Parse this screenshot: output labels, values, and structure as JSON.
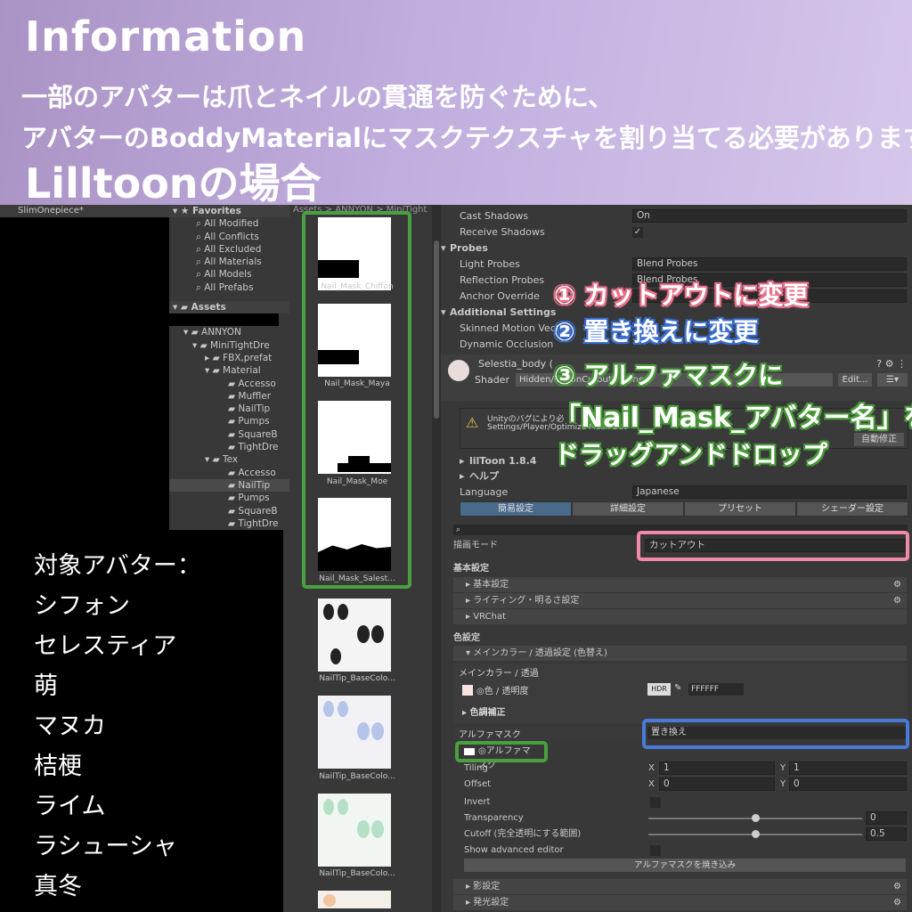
{
  "banner": {
    "title": "Information",
    "line1": "一部のアバターは爪とネイルの貫通を防ぐために、",
    "line2": "アバターのBoddyMaterialにマスクテクスチャを割り当てる必要があります。",
    "subtitle": "Lilltoonの場合"
  },
  "hierarchy": {
    "title": "SlimOnepiece*"
  },
  "project": {
    "favorites": "Favorites",
    "fav_items": [
      "All Modified",
      "All Conflicts",
      "All Excluded",
      "All Materials",
      "All Models",
      "All Prefabs"
    ],
    "assets": "Assets",
    "tree": [
      "ANNYON",
      "MiniTightDre",
      "FBX,prefat",
      "Material",
      "Accesso",
      "Muffler",
      "NailTip",
      "Pumps",
      "SquareB",
      "TightDre",
      "Tex",
      "Accesso",
      "NailTip",
      "Pumps",
      "SquareB",
      "TightDre"
    ]
  },
  "grid": {
    "breadcrumb": "Assets > ANNYON > MiniTight",
    "items": [
      "Nail_Mask_Chiffon",
      "Nail_Mask_Maya",
      "Nail_Mask_Moe",
      "Nail_Mask_Salest...",
      "NailTip_BaseColo...",
      "NailTip_BaseColo...",
      "NailTip_BaseColo..."
    ]
  },
  "inspector": {
    "cast_shadows_label": "Cast Shadows",
    "cast_shadows_value": "On",
    "receive_shadows_label": "Receive Shadows",
    "probes": "Probes",
    "light_probes_label": "Light Probes",
    "light_probes_value": "Blend Probes",
    "reflection_probes_label": "Reflection Probes",
    "reflection_probes_value": "Blend Probes",
    "anchor_override_label": "Anchor Override",
    "additional_settings": "Additional Settings",
    "skinned_motion_label": "Skinned Motion Vecto",
    "dynamic_occlusion_label": "Dynamic Occlusion",
    "material_name": "Selestia_body (",
    "shader_label": "Shader",
    "shader_value": "Hidden/lilToonCutoutOutline",
    "edit_button": "Edit...",
    "warning_text_1": "Unityのバグにより必",
    "warning_text_2": "Settings/Player/Optimize Mesh Dat",
    "auto_fix_button": "自動修正",
    "liltoon_version": "lilToon 1.8.4",
    "help": "ヘルプ",
    "language_label": "Language",
    "language_value": "Japanese",
    "tabs": [
      "簡易設定",
      "詳細設定",
      "プリセット",
      "シェーダー設定"
    ],
    "render_mode_label": "描画モード",
    "render_mode_value": "カットアウト",
    "basic_settings_header": "基本設定",
    "sec_basic": "基本設定",
    "sec_lighting": "ライティング・明るさ設定",
    "sec_vrchat": "VRChat",
    "color_settings_header": "色設定",
    "sec_main_color": "メインカラー / 透過設定 (色替え)",
    "main_color_sub": "メインカラー / 透過",
    "color_alpha_label": "◎色 / 透明度",
    "hdr": "HDR",
    "hex": "FFFFFF",
    "color_correction": "色調補正",
    "alpha_mask_label": "アルファマスク",
    "alpha_mask_mode": "置き換え",
    "alpha_mask_tex": "◎アルファマスク",
    "tiling_label": "Tiling",
    "tiling_x": "1",
    "tiling_y": "1",
    "offset_label": "Offset",
    "offset_x": "0",
    "offset_y": "0",
    "x": "X",
    "y": "Y",
    "invert_label": "Invert",
    "transparency_label": "Transparency",
    "transparency_value": "0",
    "cutoff_label": "Cutoff (完全透明にする範囲)",
    "cutoff_value": "0.5",
    "show_advanced_label": "Show advanced editor",
    "bake_button": "アルファマスクを焼き込み",
    "sec_shadow": "影設定",
    "sec_emission": "発光設定"
  },
  "annotations": {
    "step1": "① カットアウトに変更",
    "step2": "② 置き換えに変更",
    "step3": "③ アルファマスクに",
    "step3b": "「Nail_Mask_アバター名」を",
    "step3c": "ドラッグアンドドロップ"
  },
  "avatars": {
    "header": "対象アバター：",
    "list": [
      "シフォン",
      "セレスティア",
      "萌",
      "マヌカ",
      "桔梗",
      "ライム",
      "ラシューシャ",
      "真冬"
    ]
  },
  "colors": {
    "pink": "#f08aa8",
    "blue": "#4a7ad8",
    "green": "#4aa040"
  }
}
